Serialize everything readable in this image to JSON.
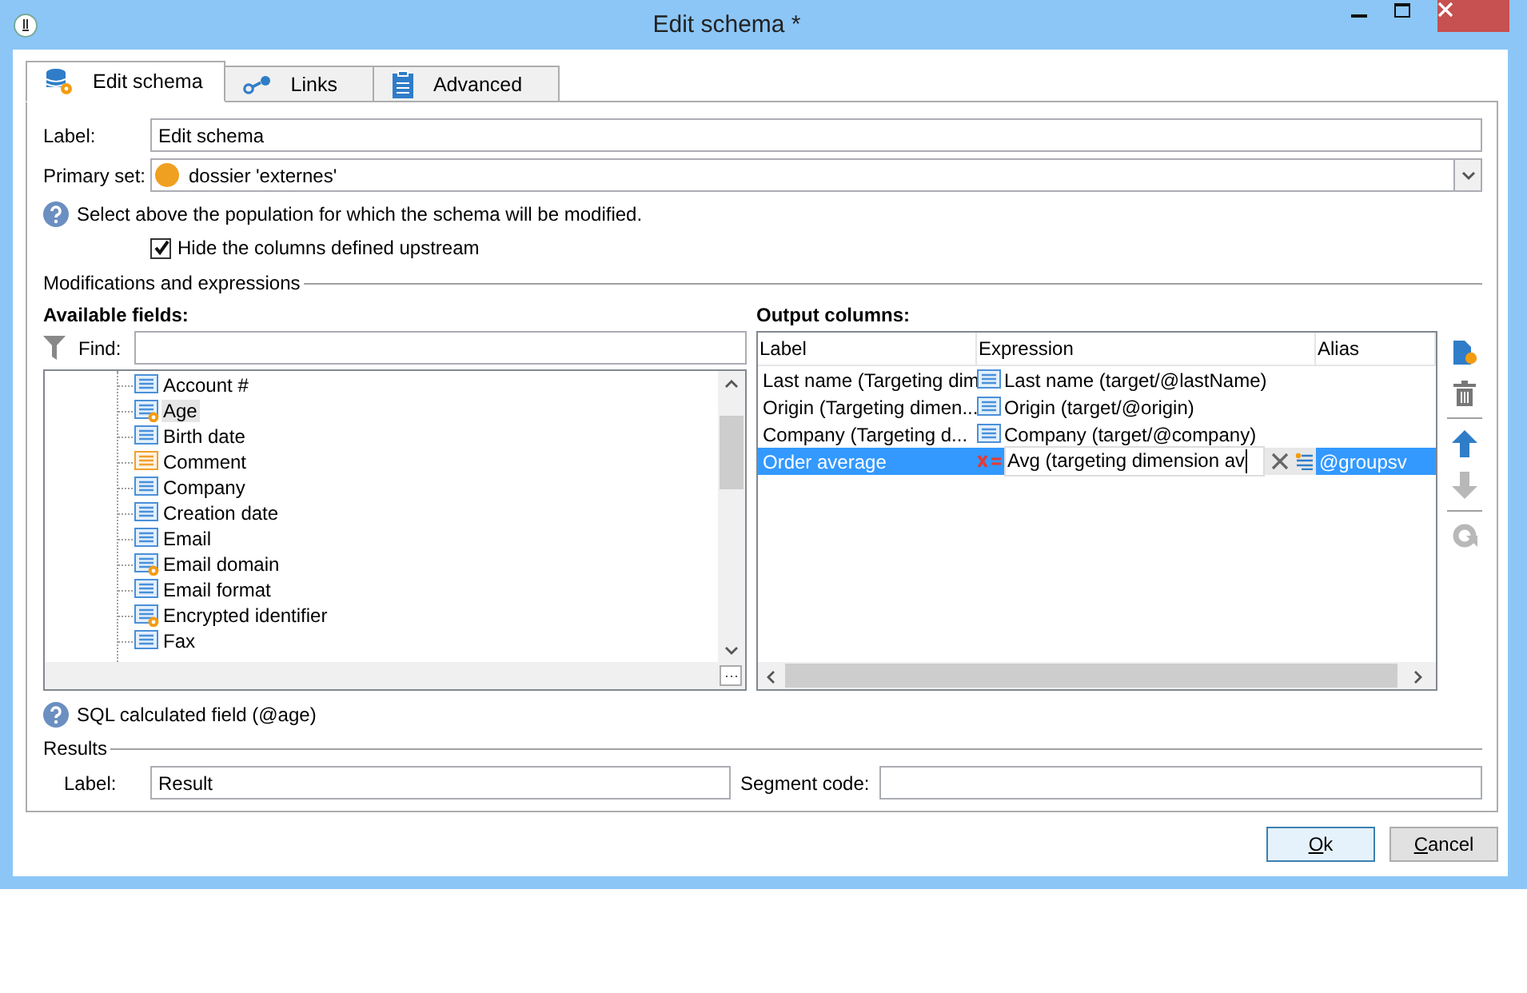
{
  "window": {
    "title": "Edit schema *"
  },
  "tabs": [
    {
      "label": "Edit schema",
      "kind": "schema",
      "selected": true
    },
    {
      "label": "Links",
      "kind": "links",
      "selected": false
    },
    {
      "label": "Advanced",
      "kind": "advanced",
      "selected": false
    }
  ],
  "form": {
    "label_caption": "Label:",
    "label_value": "Edit schema",
    "primary_set_caption": "Primary set:",
    "primary_set_value": "dossier 'externes'",
    "info": "Select above the population for which the schema will be modified.",
    "hide_columns": {
      "label": "Hide the columns defined upstream",
      "checked": true
    }
  },
  "section_title": "Modifications and expressions",
  "available_fields": {
    "title": "Available fields:",
    "find_label": "Find:",
    "items": [
      {
        "label": "Account #",
        "kind": "text",
        "selected": false
      },
      {
        "label": "Age",
        "kind": "calc",
        "selected": true
      },
      {
        "label": "Birth date",
        "kind": "text",
        "selected": false
      },
      {
        "label": "Comment",
        "kind": "memo",
        "selected": false
      },
      {
        "label": "Company",
        "kind": "text",
        "selected": false
      },
      {
        "label": "Creation date",
        "kind": "text",
        "selected": false
      },
      {
        "label": "Email",
        "kind": "text",
        "selected": false
      },
      {
        "label": "Email domain",
        "kind": "calc",
        "selected": false
      },
      {
        "label": "Email format",
        "kind": "text",
        "selected": false
      },
      {
        "label": "Encrypted identifier",
        "kind": "calc",
        "selected": false
      },
      {
        "label": "Fax",
        "kind": "text",
        "selected": false
      }
    ]
  },
  "output_columns": {
    "title": "Output columns:",
    "columns": [
      "Label",
      "Expression",
      "Alias"
    ],
    "rows": [
      {
        "label": "Last name (Targeting dim",
        "expression": "Last name (target/@lastName)",
        "kind": "field",
        "selected": false
      },
      {
        "label": "Origin (Targeting dimen...",
        "expression": "Origin (target/@origin)",
        "kind": "field",
        "selected": false
      },
      {
        "label": "Company (Targeting d...",
        "expression": "Company (target/@company)",
        "kind": "field",
        "selected": false
      },
      {
        "label": "Order average",
        "expression": "Avg (targeting dimension av",
        "alias": "@groupsv",
        "kind": "formula",
        "selected": true
      }
    ],
    "toolbar": [
      {
        "kind": "add",
        "disabled": false
      },
      {
        "kind": "delete",
        "disabled": false
      },
      {
        "kind": "up",
        "disabled": false
      },
      {
        "kind": "down",
        "disabled": true
      },
      {
        "kind": "refresh",
        "disabled": true
      }
    ]
  },
  "field_info": "SQL calculated field (@age)",
  "results": {
    "title": "Results",
    "label_caption": "Label:",
    "label_value": "Result",
    "segment_caption": "Segment code:"
  },
  "buttons": [
    {
      "label": "Ok",
      "default": true
    },
    {
      "label": "Cancel",
      "default": false
    }
  ]
}
